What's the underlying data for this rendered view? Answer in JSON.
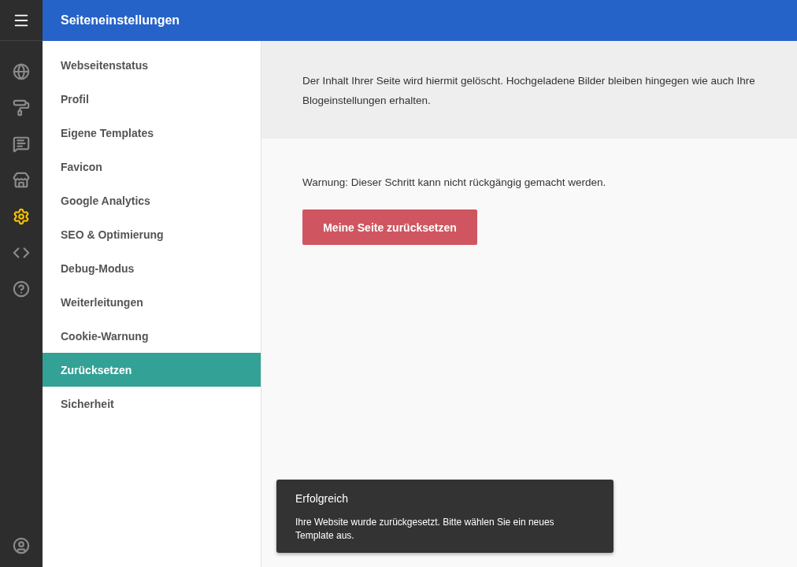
{
  "header": {
    "title": "Seiteneinstellungen"
  },
  "rail": [
    {
      "kind": "globe",
      "selected": false
    },
    {
      "kind": "roller",
      "selected": false
    },
    {
      "kind": "review",
      "selected": false
    },
    {
      "kind": "store",
      "selected": false
    },
    {
      "kind": "settings",
      "selected": true
    },
    {
      "kind": "code",
      "selected": false
    },
    {
      "kind": "help",
      "selected": false
    }
  ],
  "nav": [
    {
      "label": "Webseitenstatus",
      "selected": false
    },
    {
      "label": "Profil",
      "selected": false
    },
    {
      "label": "Eigene Templates",
      "selected": false
    },
    {
      "label": "Favicon",
      "selected": false
    },
    {
      "label": "Google Analytics",
      "selected": false
    },
    {
      "label": "SEO & Optimierung",
      "selected": false
    },
    {
      "label": "Debug-Modus",
      "selected": false
    },
    {
      "label": "Weiterleitungen",
      "selected": false
    },
    {
      "label": "Cookie-Warnung",
      "selected": false
    },
    {
      "label": "Zurücksetzen",
      "selected": true
    },
    {
      "label": "Sicherheit",
      "selected": false
    }
  ],
  "info": "Der Inhalt Ihrer Seite wird hiermit gelöscht. Hochgeladene Bilder bleiben hingegen wie auch Ihre Blogeinstellungen erhalten.",
  "warning": "Warnung: Dieser Schritt kann nicht rückgängig gemacht werden.",
  "reset_button": "Meine Seite zurücksetzen",
  "toast": {
    "title": "Erfolgreich",
    "message": "Ihre Website wurde zurückgesetzt. Bitte wählen Sie ein neues Template aus."
  }
}
